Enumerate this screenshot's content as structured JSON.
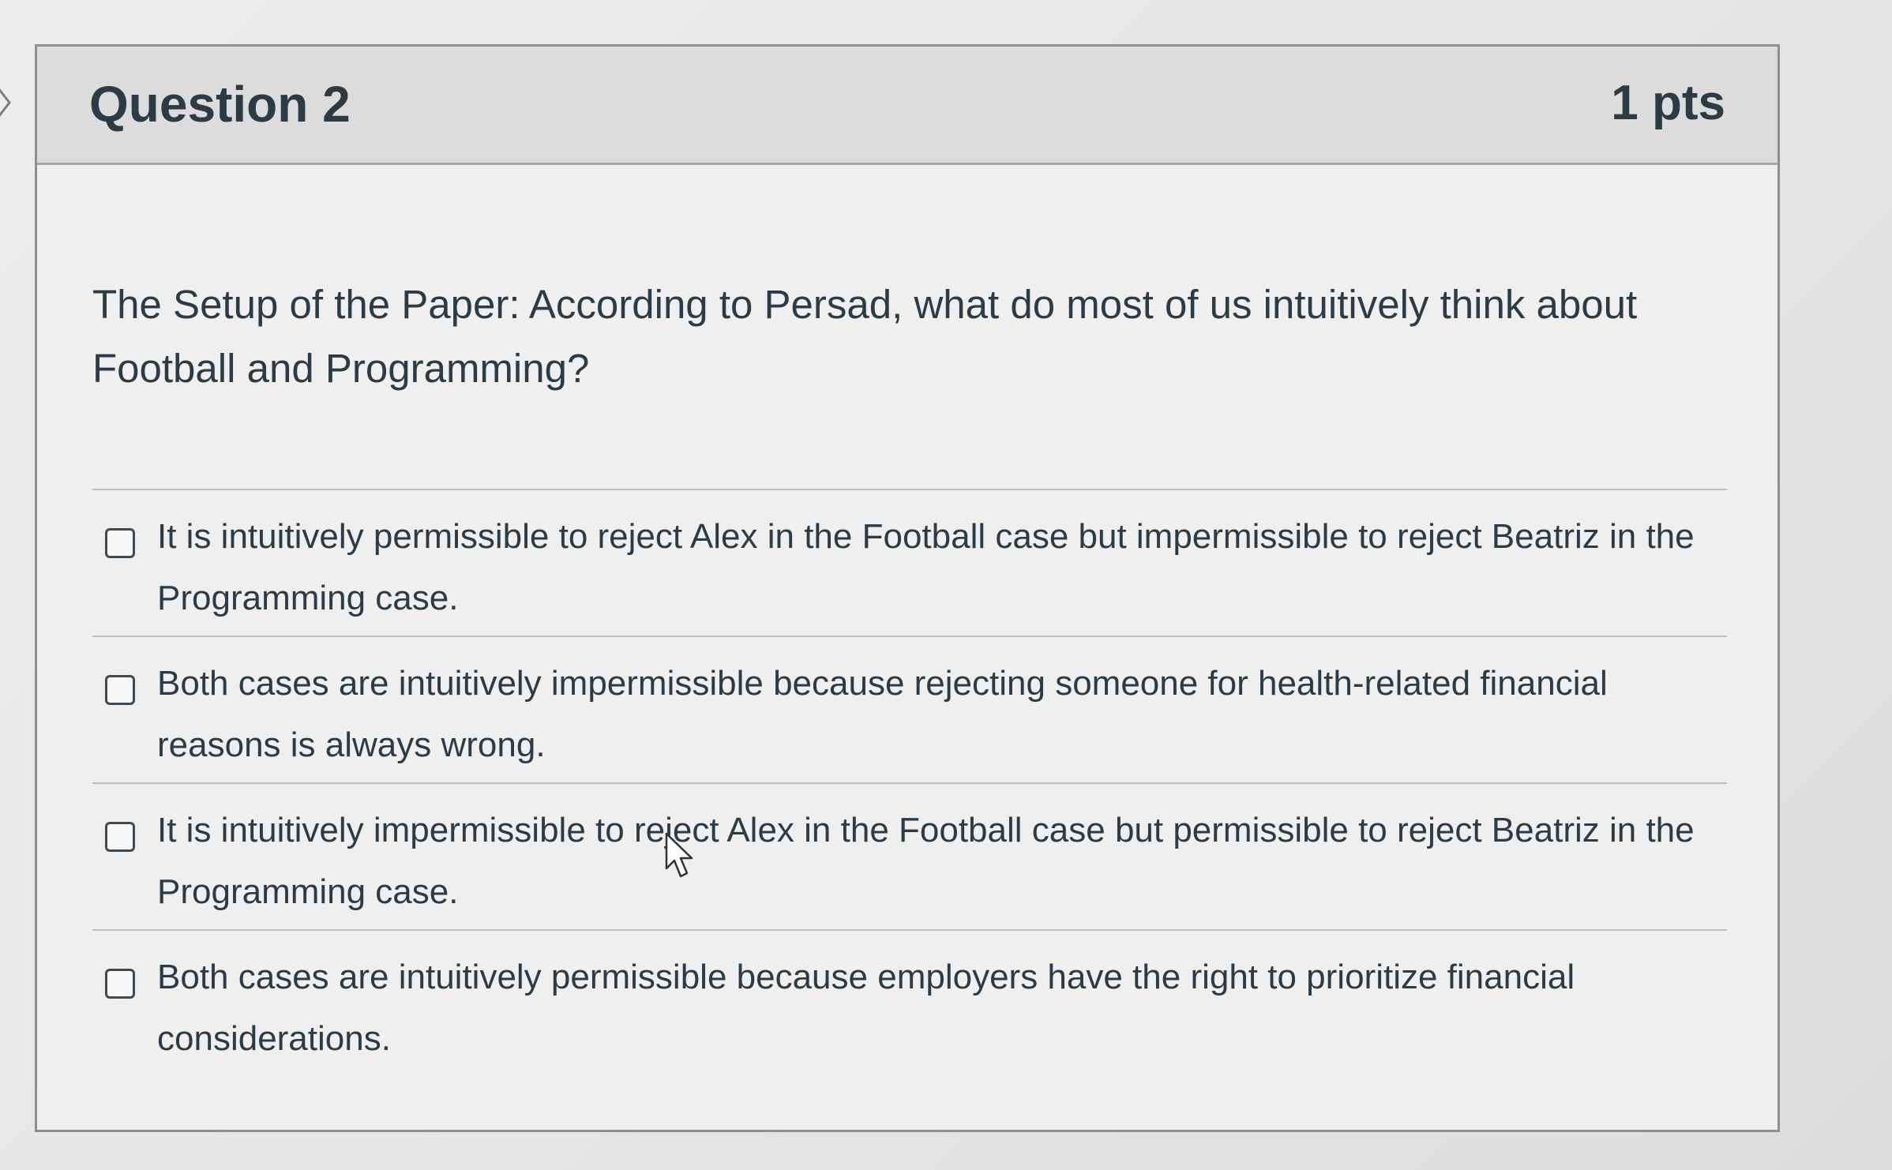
{
  "question": {
    "title": "Question 2",
    "points": "1 pts",
    "text": "The Setup of the Paper: According to Persad, what do most of us intuitively think about Football and Programming?"
  },
  "answers": [
    {
      "label": "It is intuitively permissible to reject Alex in the Football case but impermissible to reject Beatriz in the Programming case.",
      "checked": false
    },
    {
      "label": "Both cases are intuitively impermissible because rejecting someone for health-related financial reasons is always wrong.",
      "checked": false
    },
    {
      "label": "It is intuitively impermissible to reject Alex in the Football case but permissible to reject Beatriz in the Programming case.",
      "checked": false
    },
    {
      "label": "Both cases are intuitively permissible because employers have the right to prioritize financial considerations.",
      "checked": false
    }
  ],
  "icons": {
    "edge": "chevron-right-icon",
    "cursor": "mouse-pointer-icon"
  },
  "colors": {
    "text": "#2d3b45",
    "header_bg": "#dcdcdc",
    "card_bg": "#efefef",
    "border": "#8e8f90"
  }
}
